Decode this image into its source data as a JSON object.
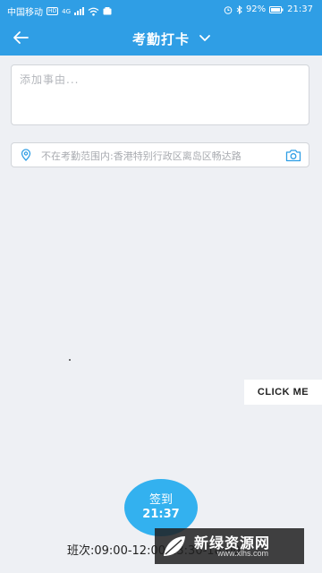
{
  "status_bar": {
    "carrier": "中国移动",
    "hd_badge": "HD",
    "network": "4G",
    "battery": "92%",
    "time": "21:37"
  },
  "header": {
    "title": "考勤打卡"
  },
  "note": {
    "placeholder": "添加事由..."
  },
  "location": {
    "text": "不在考勤范围内:香港特别行政区离岛区畅达路"
  },
  "floating_button": {
    "label": "CLICK ME"
  },
  "checkin": {
    "label": "签到",
    "time": "21:37"
  },
  "shift": {
    "text": "班次:09:00-12:00 13:30-18:00"
  },
  "watermark": {
    "text": "新绿资源网",
    "url": "www.xlhs.com"
  },
  "colors": {
    "primary": "#2f9ee5",
    "checkin": "#33b1ef",
    "background": "#eef0f4"
  }
}
